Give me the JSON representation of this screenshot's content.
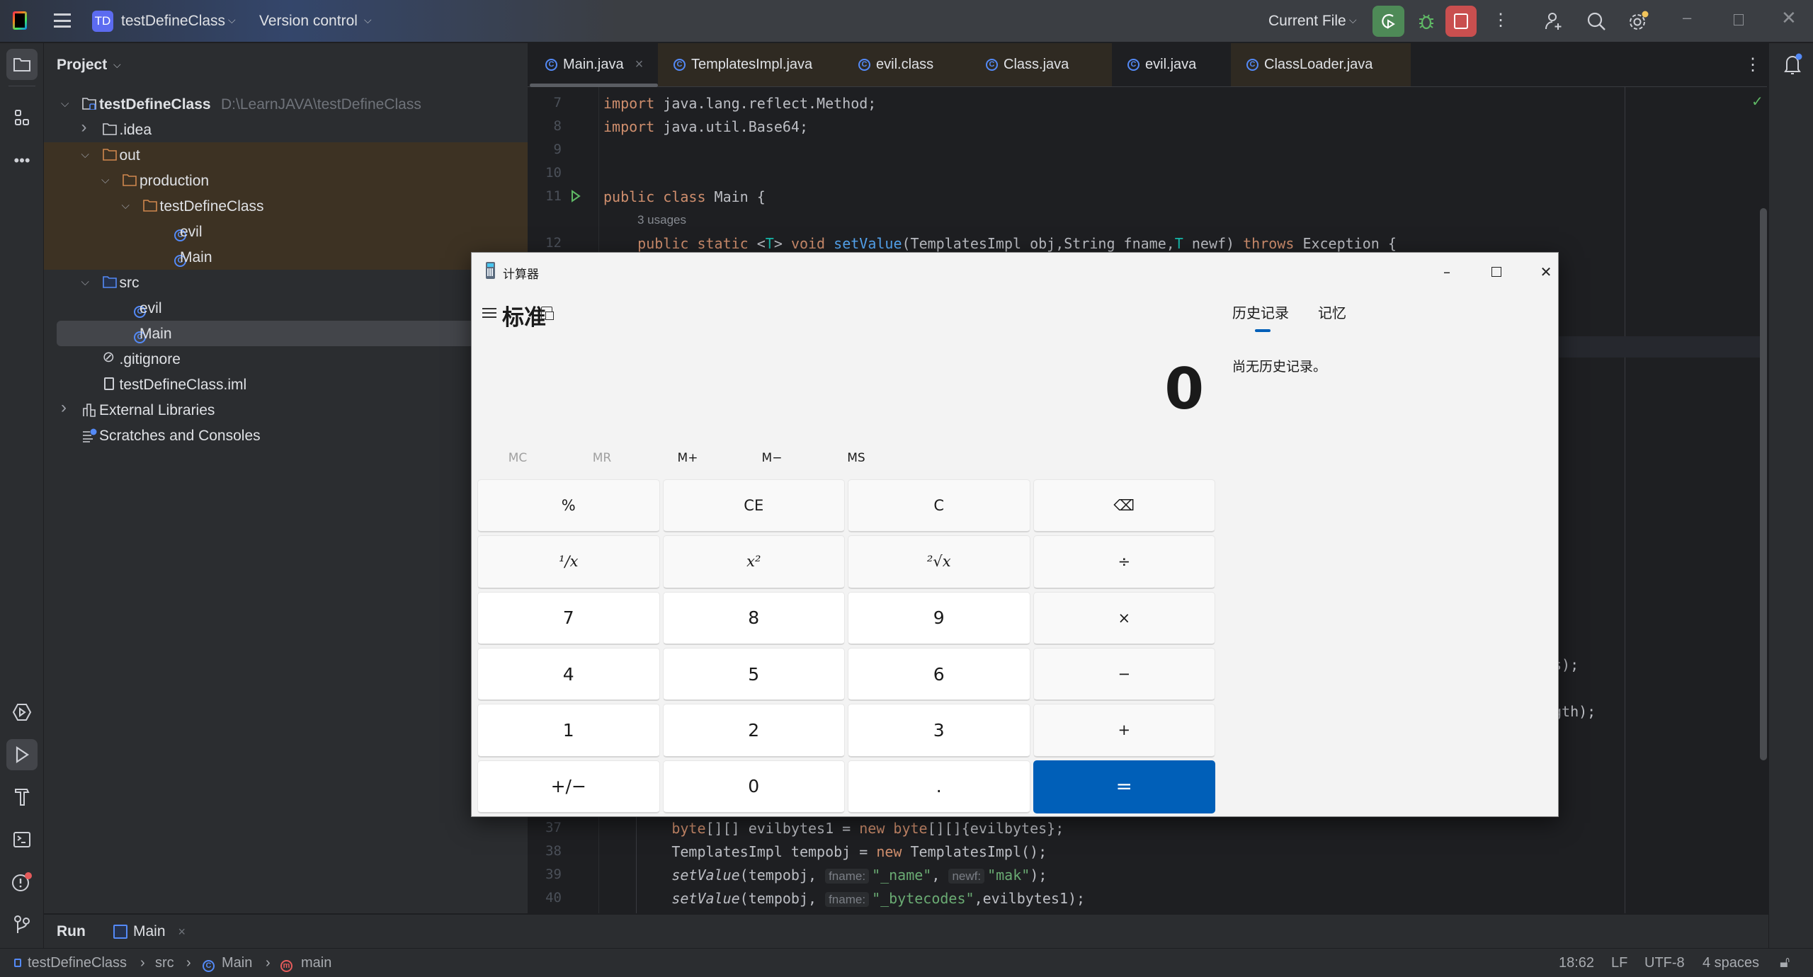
{
  "topbar": {
    "project_badge": "TD",
    "project_name": "testDefineClass",
    "vcs": "Version control",
    "run_config": "Current File"
  },
  "project_panel": {
    "title": "Project",
    "tree": [
      {
        "label": "testDefineClass",
        "hint": "D:\\LearnJAVA\\testDefineClass",
        "depth": 0,
        "arrow": "down",
        "icon": "module-folder",
        "hl": false
      },
      {
        "label": ".idea",
        "depth": 1,
        "arrow": "right",
        "icon": "folder",
        "hl": false
      },
      {
        "label": "out",
        "depth": 1,
        "arrow": "down",
        "icon": "folder-excluded",
        "hl": true
      },
      {
        "label": "production",
        "depth": 2,
        "arrow": "down",
        "icon": "folder-excluded",
        "hl": true
      },
      {
        "label": "testDefineClass",
        "depth": 3,
        "arrow": "down",
        "icon": "folder-excluded",
        "hl": true
      },
      {
        "label": "evil",
        "depth": 4,
        "arrow": "",
        "icon": "class",
        "hl": true
      },
      {
        "label": "Main",
        "depth": 4,
        "arrow": "",
        "icon": "class",
        "hl": true
      },
      {
        "label": "src",
        "depth": 1,
        "arrow": "down",
        "icon": "folder-source",
        "hl": false
      },
      {
        "label": "evil",
        "depth": 2,
        "arrow": "",
        "icon": "class",
        "hl": false
      },
      {
        "label": "Main",
        "depth": 2,
        "arrow": "",
        "icon": "class",
        "hl": false,
        "selected": true
      },
      {
        "label": ".gitignore",
        "depth": 1,
        "arrow": "",
        "icon": "ignore-file",
        "hl": false
      },
      {
        "label": "testDefineClass.iml",
        "depth": 1,
        "arrow": "",
        "icon": "iml-file",
        "hl": false
      },
      {
        "label": "External Libraries",
        "depth": 0,
        "arrow": "right",
        "icon": "library",
        "hl": false
      },
      {
        "label": "Scratches and Consoles",
        "depth": 0,
        "arrow": "",
        "icon": "scratches",
        "hl": false
      }
    ]
  },
  "editor": {
    "tabs": [
      {
        "label": "Main.java",
        "active": true,
        "modified_bg": false,
        "closable": true
      },
      {
        "label": "TemplatesImpl.java",
        "active": false,
        "modified_bg": true
      },
      {
        "label": "evil.class",
        "active": false,
        "modified_bg": true
      },
      {
        "label": "Class.java",
        "active": false,
        "modified_bg": true
      },
      {
        "label": "evil.java",
        "active": false,
        "modified_bg": false
      },
      {
        "label": "ClassLoader.java",
        "active": false,
        "modified_bg": true
      }
    ],
    "close_glyph": "×",
    "top_lines": [
      {
        "num": "7",
        "tokens": [
          [
            "import ",
            "kw"
          ],
          [
            "java.lang.reflect.Method;",
            "id"
          ]
        ]
      },
      {
        "num": "8",
        "tokens": [
          [
            "import ",
            "kw"
          ],
          [
            "java.util.Base64;",
            "id"
          ]
        ]
      },
      {
        "num": "9",
        "tokens": []
      },
      {
        "num": "10",
        "tokens": []
      },
      {
        "num": "11",
        "run_icon": true,
        "tokens": [
          [
            "public class ",
            "kw"
          ],
          [
            "Main",
            "id"
          ],
          [
            " {",
            "id"
          ]
        ]
      },
      {
        "num": "",
        "usages": "3 usages"
      },
      {
        "num": "12",
        "tokens": [
          [
            "    public static ",
            "kw"
          ],
          [
            "<",
            "id"
          ],
          [
            "T",
            "tp"
          ],
          [
            "> ",
            "id"
          ],
          [
            "void ",
            "kw"
          ],
          [
            "setValue",
            "fn"
          ],
          [
            "(TemplatesImpl obj,String fname,",
            "id"
          ],
          [
            "T",
            "tp"
          ],
          [
            " newf) ",
            "id"
          ],
          [
            "throws ",
            "kw"
          ],
          [
            "Exception {",
            "id"
          ]
        ]
      }
    ],
    "bottom_lines": [
      {
        "num": "37",
        "tokens": [
          [
            "        byte",
            "kw"
          ],
          [
            "[][] evilbytes1 = ",
            "id"
          ],
          [
            "new ",
            "kw"
          ],
          [
            "byte",
            "kw"
          ],
          [
            "[][]{evilbytes};",
            "id"
          ]
        ]
      },
      {
        "num": "38",
        "tokens": [
          [
            "        TemplatesImpl tempobj = ",
            "id"
          ],
          [
            "new ",
            "kw"
          ],
          [
            "TemplatesImpl();",
            "id"
          ]
        ]
      },
      {
        "num": "39",
        "tokens": [
          [
            "        ",
            "id"
          ],
          [
            "setValue",
            "id it"
          ],
          [
            "(tempobj, ",
            "id"
          ],
          [
            "fname:",
            "inlay"
          ],
          [
            "\"_name\"",
            "str"
          ],
          [
            ", ",
            "id"
          ],
          [
            "newf:",
            "inlay"
          ],
          [
            "\"mak\"",
            "str"
          ],
          [
            ");",
            "id"
          ]
        ]
      },
      {
        "num": "40",
        "tokens": [
          [
            "        ",
            "id"
          ],
          [
            "setValue",
            "id it"
          ],
          [
            "(tempobj, ",
            "id"
          ],
          [
            "fname:",
            "inlay"
          ],
          [
            "\"_bytecodes\"",
            "str"
          ],
          [
            ",evilbytes1);",
            "id"
          ]
        ]
      }
    ],
    "occluded_fragments": [
      "s);",
      "gth);"
    ]
  },
  "run_panel": {
    "title": "Run",
    "tab": "Main"
  },
  "statusbar": {
    "breadcrumbs": [
      "testDefineClass",
      "src",
      "Main",
      "main"
    ],
    "position": "18:62",
    "line_ending": "LF",
    "encoding": "UTF-8",
    "indent": "4 spaces"
  },
  "calculator": {
    "title": "计算器",
    "mode": "标准",
    "display": "0",
    "tabs": [
      "历史记录",
      "记忆"
    ],
    "history_empty": "尚无历史记录。",
    "memory": [
      {
        "label": "MC",
        "enabled": false
      },
      {
        "label": "MR",
        "enabled": false
      },
      {
        "label": "M+",
        "enabled": true
      },
      {
        "label": "M−",
        "enabled": true
      },
      {
        "label": "MS",
        "enabled": true
      }
    ],
    "keys": [
      {
        "label": "%",
        "kind": "fn",
        "name": "percent"
      },
      {
        "label": "CE",
        "kind": "fn",
        "name": "clear-entry"
      },
      {
        "label": "C",
        "kind": "fn",
        "name": "clear"
      },
      {
        "label": "⌫",
        "kind": "fn",
        "name": "backspace"
      },
      {
        "label": "¹/x",
        "kind": "math",
        "name": "reciprocal"
      },
      {
        "label": "x²",
        "kind": "math",
        "name": "square"
      },
      {
        "label": "²√x",
        "kind": "math",
        "name": "square-root"
      },
      {
        "label": "÷",
        "kind": "fn",
        "name": "divide"
      },
      {
        "label": "7",
        "kind": "num",
        "name": "digit-7"
      },
      {
        "label": "8",
        "kind": "num",
        "name": "digit-8"
      },
      {
        "label": "9",
        "kind": "num",
        "name": "digit-9"
      },
      {
        "label": "×",
        "kind": "fn",
        "name": "multiply"
      },
      {
        "label": "4",
        "kind": "num",
        "name": "digit-4"
      },
      {
        "label": "5",
        "kind": "num",
        "name": "digit-5"
      },
      {
        "label": "6",
        "kind": "num",
        "name": "digit-6"
      },
      {
        "label": "−",
        "kind": "fn",
        "name": "subtract"
      },
      {
        "label": "1",
        "kind": "num",
        "name": "digit-1"
      },
      {
        "label": "2",
        "kind": "num",
        "name": "digit-2"
      },
      {
        "label": "3",
        "kind": "num",
        "name": "digit-3"
      },
      {
        "label": "+",
        "kind": "fn",
        "name": "add"
      },
      {
        "label": "+/−",
        "kind": "num",
        "name": "negate"
      },
      {
        "label": "0",
        "kind": "num",
        "name": "digit-0"
      },
      {
        "label": ".",
        "kind": "num",
        "name": "decimal"
      },
      {
        "label": "=",
        "kind": "eq",
        "name": "equals"
      }
    ],
    "accent": "#005fb8"
  },
  "colors": {
    "run_green": "#4e8a57",
    "stop_red": "#c94f4f",
    "excluded_bg": "#3d3223"
  }
}
